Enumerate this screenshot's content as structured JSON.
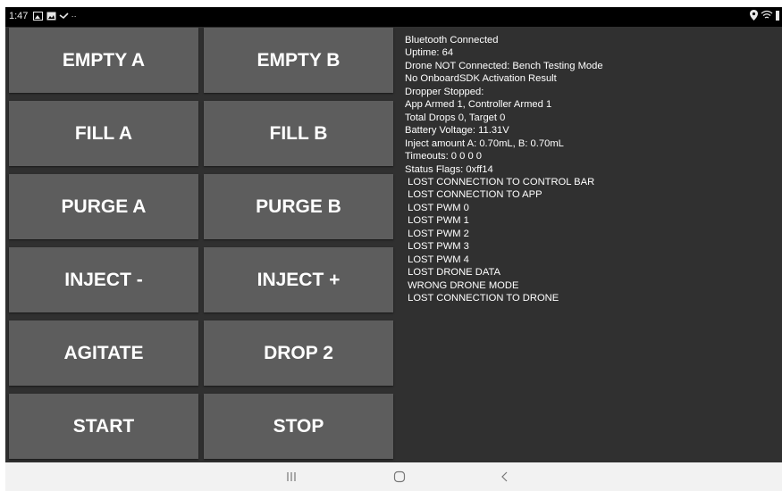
{
  "status_bar": {
    "time": "1:47",
    "left_icons": [
      "image-icon",
      "photo-icon",
      "check-icon",
      "more-dots-icon"
    ],
    "right_icons": [
      "location-icon",
      "wifi-icon",
      "battery-icon"
    ]
  },
  "buttons": [
    {
      "label": "EMPTY A"
    },
    {
      "label": "EMPTY B"
    },
    {
      "label": "FILL A"
    },
    {
      "label": "FILL B"
    },
    {
      "label": "PURGE A"
    },
    {
      "label": "PURGE B"
    },
    {
      "label": "INJECT -"
    },
    {
      "label": "INJECT +"
    },
    {
      "label": "AGITATE"
    },
    {
      "label": "DROP 2"
    },
    {
      "label": "START"
    },
    {
      "label": "STOP"
    }
  ],
  "status_lines": [
    "Bluetooth Connected",
    "Uptime: 64",
    "Drone NOT Connected: Bench Testing Mode",
    "No OnboardSDK Activation Result",
    "Dropper Stopped:",
    "App Armed 1, Controller Armed 1",
    "Total Drops 0, Target 0",
    "Battery Voltage: 11.31V",
    "Inject amount A: 0.70mL, B: 0.70mL",
    "Timeouts: 0 0 0 0",
    "Status Flags: 0xff14",
    " LOST CONNECTION TO CONTROL BAR",
    " LOST CONNECTION TO APP",
    " LOST PWM 0",
    " LOST PWM 1",
    " LOST PWM 2",
    " LOST PWM 3",
    " LOST PWM 4",
    " LOST DRONE DATA",
    " WRONG DRONE MODE",
    " LOST CONNECTION TO DRONE"
  ],
  "nav_bar": {
    "icons": [
      "recent-apps-icon",
      "home-icon",
      "back-icon"
    ]
  },
  "colors": {
    "background": "#303030",
    "button": "#5d5d5d",
    "text": "#ffffff",
    "status_bar": "#000000",
    "nav_bar": "#f2f2f2"
  }
}
